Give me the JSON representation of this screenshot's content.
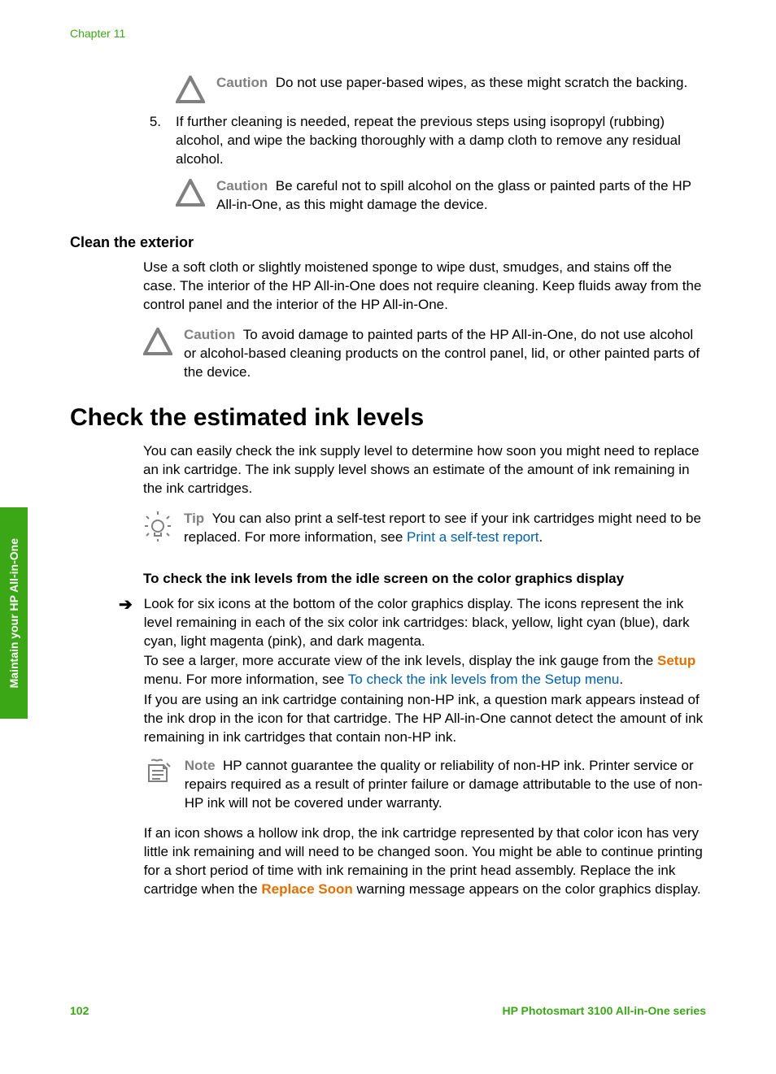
{
  "sideTab": "Maintain your HP All-in-One",
  "chapter": "Chapter 11",
  "caution1_label": "Caution",
  "caution1_text": "Do not use paper-based wipes, as these might scratch the backing.",
  "step5_num": "5.",
  "step5_text": "If further cleaning is needed, repeat the previous steps using isopropyl (rubbing) alcohol, and wipe the backing thoroughly with a damp cloth to remove any residual alcohol.",
  "caution2_label": "Caution",
  "caution2_text": "Be careful not to spill alcohol on the glass or painted parts of the HP All-in-One, as this might damage the device.",
  "h3_clean": "Clean the exterior",
  "clean_para": "Use a soft cloth or slightly moistened sponge to wipe dust, smudges, and stains off the case. The interior of the HP All-in-One does not require cleaning. Keep fluids away from the control panel and the interior of the HP All-in-One.",
  "caution3_label": "Caution",
  "caution3_text": "To avoid damage to painted parts of the HP All-in-One, do not use alcohol or alcohol-based cleaning products on the control panel, lid, or other painted parts of the device.",
  "h1_check": "Check the estimated ink levels",
  "check_para": "You can easily check the ink supply level to determine how soon you might need to replace an ink cartridge. The ink supply level shows an estimate of the amount of ink remaining in the ink cartridges.",
  "tip_label": "Tip",
  "tip_text_a": "You can also print a self-test report to see if your ink cartridges might need to be replaced. For more information, see ",
  "tip_link": "Print a self-test report",
  "subhead": "To check the ink levels from the idle screen on the color graphics display",
  "arrow_glyph": "➔",
  "arrow_p1": "Look for six icons at the bottom of the color graphics display. The icons represent the ink level remaining in each of the six color ink cartridges: black, yellow, light cyan (blue), dark cyan, light magenta (pink), and dark magenta.",
  "arrow_p2a": "To see a larger, more accurate view of the ink levels, display the ink gauge from the ",
  "setup_label": "Setup",
  "arrow_p2b": " menu. For more information, see ",
  "arrow_link2": "To check the ink levels from the Setup menu",
  "arrow_p3": "If you are using an ink cartridge containing non-HP ink, a question mark appears instead of the ink drop in the icon for that cartridge. The HP All-in-One cannot detect the amount of ink remaining in ink cartridges that contain non-HP ink.",
  "note_label": "Note",
  "note_text": "HP cannot guarantee the quality or reliability of non-HP ink. Printer service or repairs required as a result of printer failure or damage attributable to the use of non-HP ink will not be covered under warranty.",
  "arrow_p4a": "If an icon shows a hollow ink drop, the ink cartridge represented by that color icon has very little ink remaining and will need to be changed soon. You might be able to continue printing for a short period of time with ink remaining in the print head assembly. Replace the ink cartridge when the ",
  "replace_soon": "Replace Soon",
  "arrow_p4b": " warning message appears on the color graphics display.",
  "page_num": "102",
  "footer_right": "HP Photosmart 3100 All-in-One series"
}
